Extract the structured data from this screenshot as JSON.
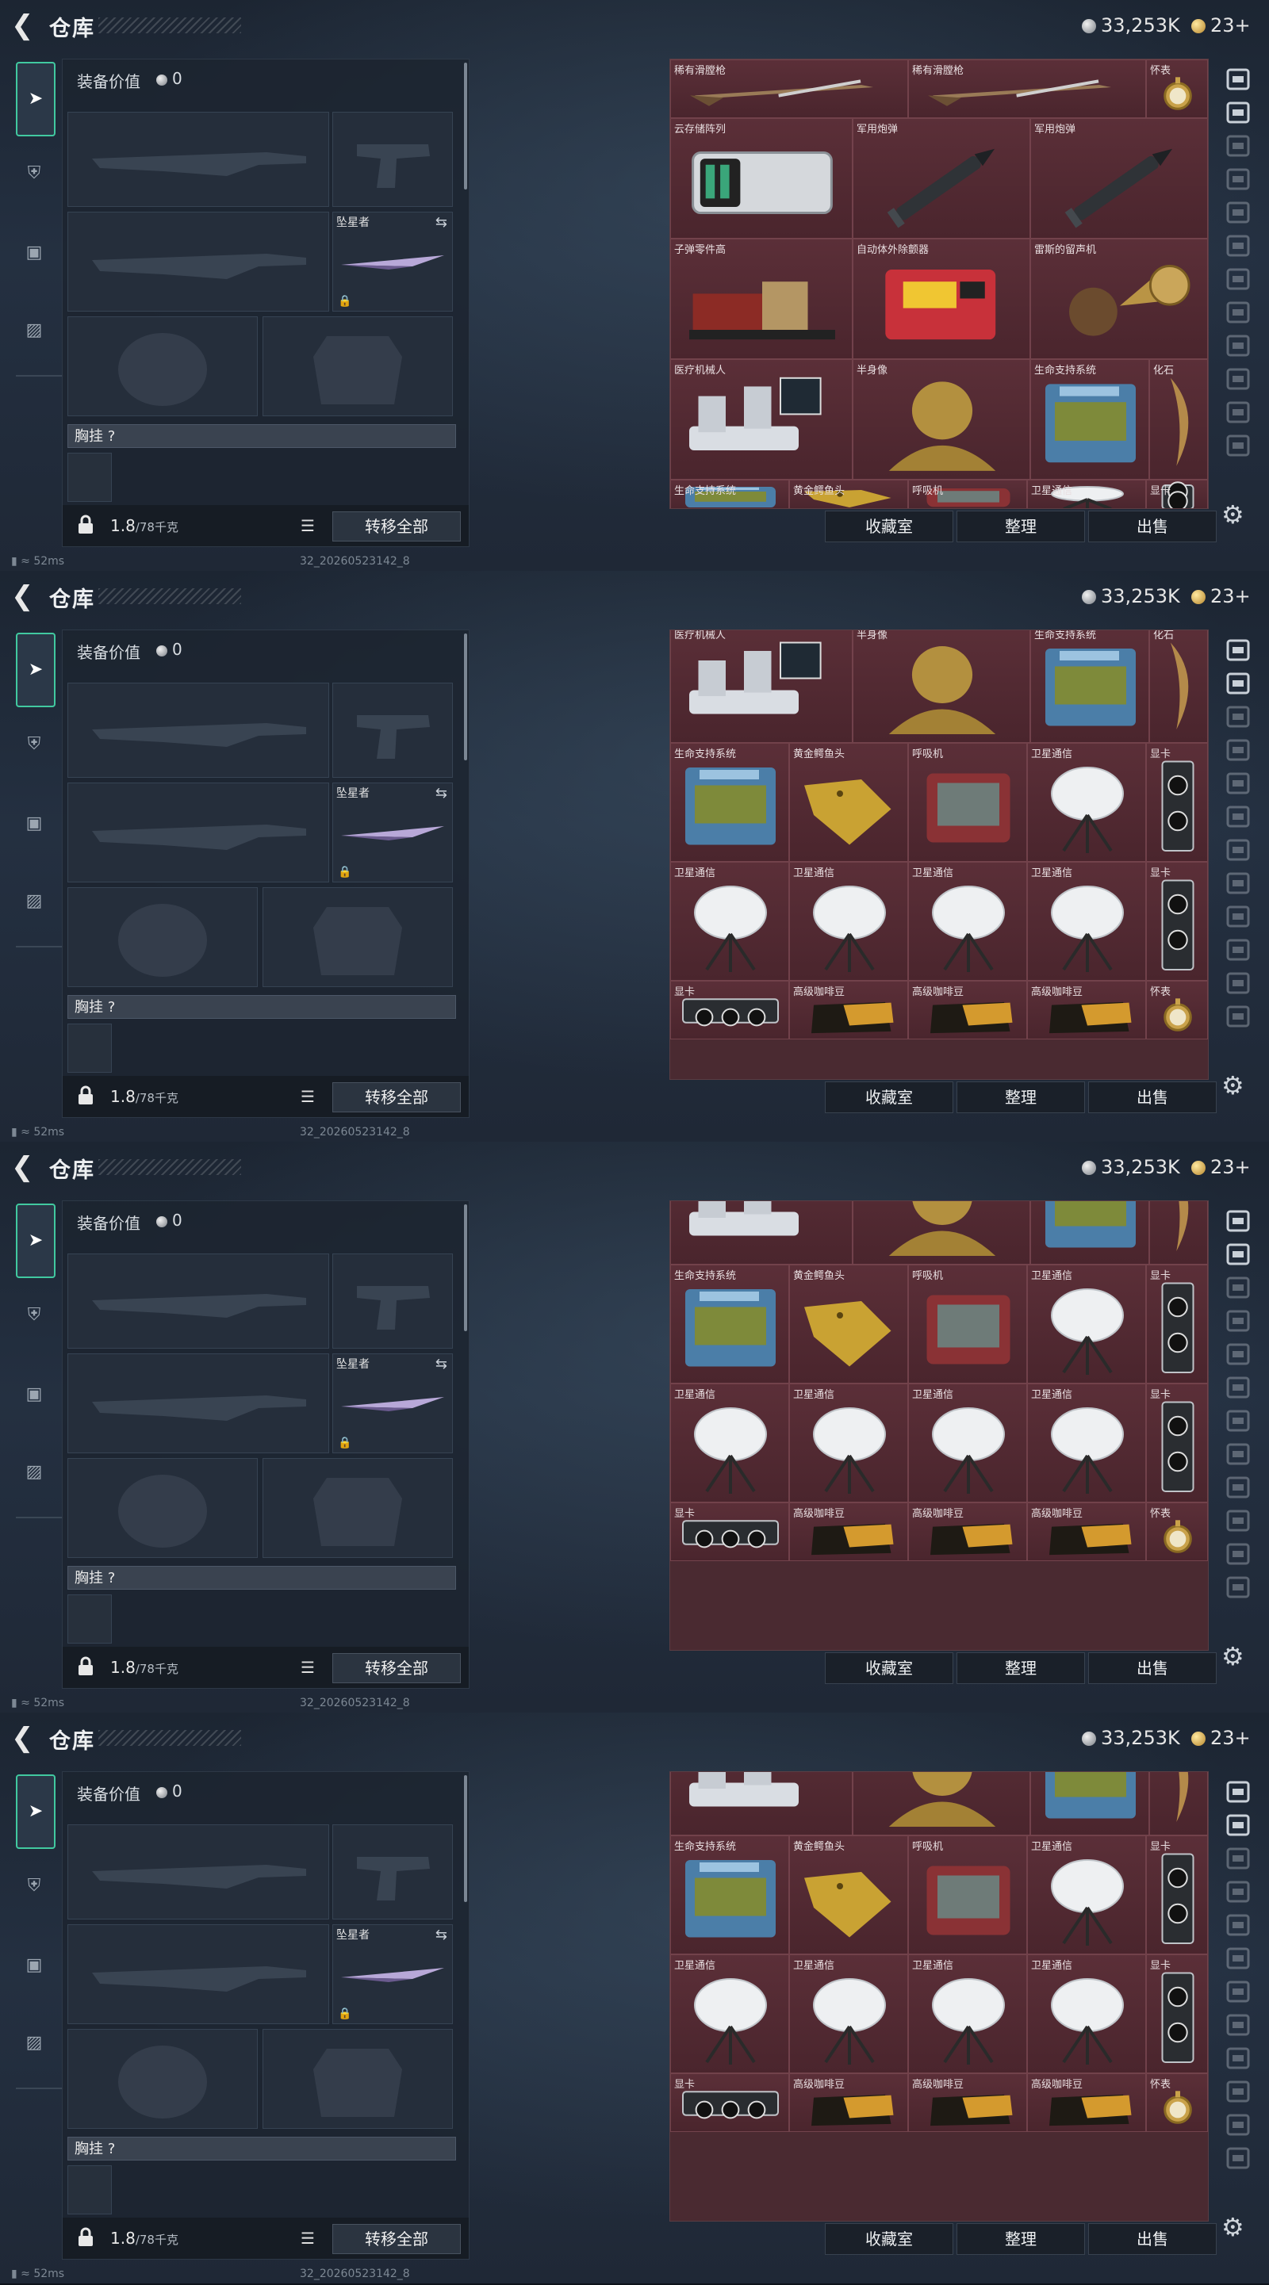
{
  "header": {
    "title": "仓库",
    "silver_amount": "33,253K",
    "gold_amount": "23+"
  },
  "equipment": {
    "value_label": "装备价值",
    "value_amount": "0",
    "melee_label": "坠星者",
    "chest_rig_label": "胸挂 ?",
    "weight_value": "1.8",
    "weight_capacity": "/78千克",
    "transfer_all": "转移全部"
  },
  "status": {
    "ping": "52ms",
    "build": "32_20260523142_8"
  },
  "stash_actions": {
    "collection": "收藏室",
    "organize": "整理",
    "sell": "出售"
  },
  "frames": [
    {
      "rows": [
        [
          {
            "label": "稀有滑膛枪",
            "icon": "rifle"
          },
          {
            "label": "稀有滑膛枪",
            "icon": "rifle"
          },
          {
            "label": "怀表",
            "icon": "watch"
          }
        ],
        [
          {
            "label": "云存储阵列",
            "icon": "server"
          },
          {
            "label": "军用炮弹",
            "icon": "shell"
          },
          {
            "label": "军用炮弹",
            "icon": "shell"
          }
        ],
        [
          {
            "label": "子弹零件高",
            "icon": "parts"
          },
          {
            "label": "自动体外除颤器",
            "icon": "defib"
          },
          {
            "label": "雷斯的留声机",
            "icon": "phono"
          }
        ],
        [
          {
            "label": "医疗机械人",
            "icon": "robot"
          },
          {
            "label": "半身像",
            "icon": "bust"
          },
          {
            "label": "生命支持系统",
            "icon": "life"
          },
          {
            "label": "化石",
            "icon": "fossil"
          }
        ],
        [
          {
            "label": "生命支持系统",
            "icon": "life"
          },
          {
            "label": "黄金鳄鱼头",
            "icon": "croc"
          },
          {
            "label": "呼吸机",
            "icon": "vent"
          },
          {
            "label": "卫星通信",
            "icon": "dish"
          },
          {
            "label": "显卡",
            "icon": "gpu"
          }
        ]
      ]
    },
    {
      "rows": [
        [
          {
            "label": "医疗机械人",
            "icon": "robot"
          },
          {
            "label": "半身像",
            "icon": "bust"
          },
          {
            "label": "生命支持系统",
            "icon": "life"
          },
          {
            "label": "化石",
            "icon": "fossil"
          }
        ],
        [
          {
            "label": "生命支持系统",
            "icon": "life"
          },
          {
            "label": "黄金鳄鱼头",
            "icon": "croc"
          },
          {
            "label": "呼吸机",
            "icon": "vent"
          },
          {
            "label": "卫星通信",
            "icon": "dish"
          },
          {
            "label": "显卡",
            "icon": "gpu"
          }
        ],
        [
          {
            "label": "卫星通信",
            "icon": "dish"
          },
          {
            "label": "卫星通信",
            "icon": "dish"
          },
          {
            "label": "卫星通信",
            "icon": "dish"
          },
          {
            "label": "卫星通信",
            "icon": "dish"
          },
          {
            "label": "显卡",
            "icon": "gpu"
          }
        ],
        [
          {
            "label": "显卡",
            "icon": "gpu"
          },
          {
            "label": "高级咖啡豆",
            "icon": "coffee"
          },
          {
            "label": "高级咖啡豆",
            "icon": "coffee"
          },
          {
            "label": "高级咖啡豆",
            "icon": "coffee"
          },
          {
            "label": "怀表",
            "icon": "watch"
          }
        ]
      ]
    },
    {
      "rows": [
        [
          {
            "label": "",
            "icon": "robot"
          },
          {
            "label": "",
            "icon": "bust"
          },
          {
            "label": "",
            "icon": "life"
          },
          {
            "label": "",
            "icon": "fossil"
          }
        ],
        [
          {
            "label": "生命支持系统",
            "icon": "life"
          },
          {
            "label": "黄金鳄鱼头",
            "icon": "croc"
          },
          {
            "label": "呼吸机",
            "icon": "vent"
          },
          {
            "label": "卫星通信",
            "icon": "dish"
          },
          {
            "label": "显卡",
            "icon": "gpu"
          }
        ],
        [
          {
            "label": "卫星通信",
            "icon": "dish"
          },
          {
            "label": "卫星通信",
            "icon": "dish"
          },
          {
            "label": "卫星通信",
            "icon": "dish"
          },
          {
            "label": "卫星通信",
            "icon": "dish"
          },
          {
            "label": "显卡",
            "icon": "gpu"
          }
        ],
        [
          {
            "label": "显卡",
            "icon": "gpu"
          },
          {
            "label": "高级咖啡豆",
            "icon": "coffee"
          },
          {
            "label": "高级咖啡豆",
            "icon": "coffee"
          },
          {
            "label": "高级咖啡豆",
            "icon": "coffee"
          },
          {
            "label": "怀表",
            "icon": "watch"
          }
        ]
      ]
    },
    {
      "rows": [
        [
          {
            "label": "",
            "icon": "robot"
          },
          {
            "label": "",
            "icon": "bust"
          },
          {
            "label": "",
            "icon": "life"
          },
          {
            "label": "",
            "icon": "fossil"
          }
        ],
        [
          {
            "label": "生命支持系统",
            "icon": "life"
          },
          {
            "label": "黄金鳄鱼头",
            "icon": "croc"
          },
          {
            "label": "呼吸机",
            "icon": "vent"
          },
          {
            "label": "卫星通信",
            "icon": "dish"
          },
          {
            "label": "显卡",
            "icon": "gpu"
          }
        ],
        [
          {
            "label": "卫星通信",
            "icon": "dish"
          },
          {
            "label": "卫星通信",
            "icon": "dish"
          },
          {
            "label": "卫星通信",
            "icon": "dish"
          },
          {
            "label": "卫星通信",
            "icon": "dish"
          },
          {
            "label": "显卡",
            "icon": "gpu"
          }
        ],
        [
          {
            "label": "显卡",
            "icon": "gpu"
          },
          {
            "label": "高级咖啡豆",
            "icon": "coffee"
          },
          {
            "label": "高级咖啡豆",
            "icon": "coffee"
          },
          {
            "label": "高级咖啡豆",
            "icon": "coffee"
          },
          {
            "label": "怀表",
            "icon": "watch"
          }
        ]
      ]
    }
  ],
  "icons": {
    "back": "chevron-left-icon",
    "silver": "silver-coin-icon",
    "gold": "gold-coin-icon",
    "settings": "gear-icon",
    "lock": "lock-icon",
    "list": "list-icon"
  }
}
